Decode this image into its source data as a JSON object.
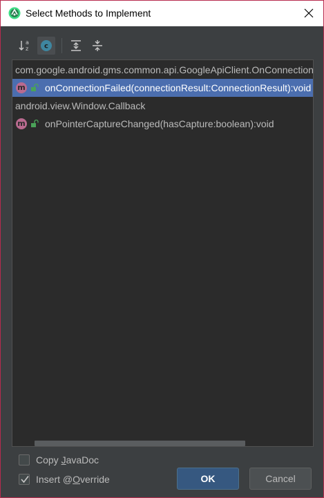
{
  "window": {
    "title": "Select Methods to Implement",
    "border_color": "#b72a4e"
  },
  "toolbar": {
    "buttons": [
      {
        "name": "sort-alphabetically",
        "icon": "sort-az-icon",
        "active": false
      },
      {
        "name": "show-classes",
        "icon": "class-c-icon",
        "active": true
      },
      {
        "name": "expand-all",
        "icon": "expand-all-icon",
        "active": false
      },
      {
        "name": "collapse-all",
        "icon": "collapse-all-icon",
        "active": false
      }
    ]
  },
  "list": {
    "rows": [
      {
        "type": "group",
        "label": "com.google.android.gms.common.api.GoogleApiClient.OnConnectionFailedListener"
      },
      {
        "type": "method",
        "label": "onConnectionFailed(connectionResult:ConnectionResult):void",
        "selected": true,
        "icon": "method-m-icon"
      },
      {
        "type": "group",
        "label": "android.view.Window.Callback"
      },
      {
        "type": "method",
        "label": "onPointerCaptureChanged(hasCapture:boolean):void",
        "selected": false,
        "icon": "method-m-icon"
      }
    ]
  },
  "options": {
    "copy_javadoc": {
      "label_pre": "Copy ",
      "label_mnemonic": "J",
      "label_post": "avaDoc",
      "checked": false
    },
    "insert_override": {
      "label_pre": "Insert @",
      "label_mnemonic": "O",
      "label_post": "verride",
      "checked": true
    }
  },
  "buttons": {
    "ok": "OK",
    "cancel": "Cancel"
  },
  "colors": {
    "accent": "#365880",
    "selection": "#4b6eaf",
    "method_badge": "#b96a8f"
  }
}
